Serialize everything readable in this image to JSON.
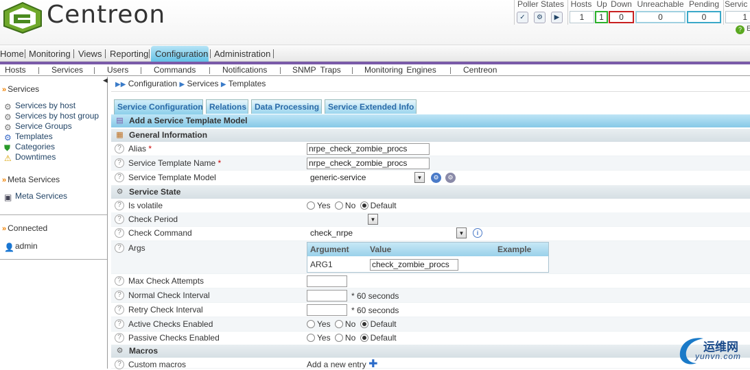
{
  "brand": {
    "name": "Centreon"
  },
  "status": {
    "poller_label": "Poller States",
    "hosts_label": "Hosts",
    "up_label": "Up",
    "down_label": "Down",
    "unreachable_label": "Unreachable",
    "pending_label": "Pending",
    "services_label": "Servic",
    "hosts_value": "1",
    "up_value": "1",
    "down_value": "0",
    "unreachable_value": "0",
    "pending_value": "0",
    "services_value": "1"
  },
  "topnav": {
    "items": [
      "Home",
      "Monitoring",
      "Views",
      "Reporting",
      "Configuration",
      "Administration"
    ],
    "active": "Configuration"
  },
  "subnav": {
    "items": [
      "Hosts",
      "Services",
      "Users",
      "Commands",
      "Notifications",
      "SNMP Traps",
      "Monitoring Engines",
      "Centreon"
    ]
  },
  "sidebar": {
    "section_services": "Services",
    "items": [
      "Services by host",
      "Services by host group",
      "Service Groups",
      "Templates",
      "Categories",
      "Downtimes"
    ],
    "section_meta": "Meta Services",
    "meta_item": "Meta Services",
    "section_connected": "Connected",
    "user": "admin"
  },
  "breadcrumb": [
    "Configuration",
    "Services",
    "Templates"
  ],
  "tabs": [
    "Service Configuration",
    "Relations",
    "Data Processing",
    "Service Extended Info"
  ],
  "form": {
    "title": "Add a Service Template Model",
    "section_general": "General Information",
    "alias_label": "Alias",
    "alias_value": "nrpe_check_zombie_procs",
    "stn_label": "Service Template Name",
    "stn_value": "nrpe_check_zombie_procs",
    "stm_label": "Service Template Model",
    "stm_value": "generic-service",
    "section_state": "Service State",
    "volatile_label": "Is volatile",
    "check_period_label": "Check Period",
    "check_period_value": "",
    "check_command_label": "Check Command",
    "check_command_value": "check_nrpe",
    "args_label": "Args",
    "args_headers": [
      "Argument",
      "Value",
      "Example"
    ],
    "args_rows": [
      {
        "argument": "ARG1",
        "value": "check_zombie_procs",
        "example": ""
      }
    ],
    "max_attempts_label": "Max Check Attempts",
    "normal_interval_label": "Normal Check Interval",
    "retry_interval_label": "Retry Check Interval",
    "interval_unit": "* 60 seconds",
    "active_checks_label": "Active Checks Enabled",
    "passive_checks_label": "Passive Checks Enabled",
    "section_macros": "Macros",
    "custom_macros_label": "Custom macros",
    "add_entry_label": "Add a new entry",
    "radio_yes": "Yes",
    "radio_no": "No",
    "radio_default": "Default",
    "required_mark": "*"
  },
  "watermark": {
    "cn": "运维网",
    "url": "yunvn.com"
  },
  "colors": {
    "accent": "#63c1e6",
    "nav_line": "#7a5aa8",
    "up": "#2bb02b",
    "down": "#c82020",
    "pending": "#3aa8c8"
  }
}
